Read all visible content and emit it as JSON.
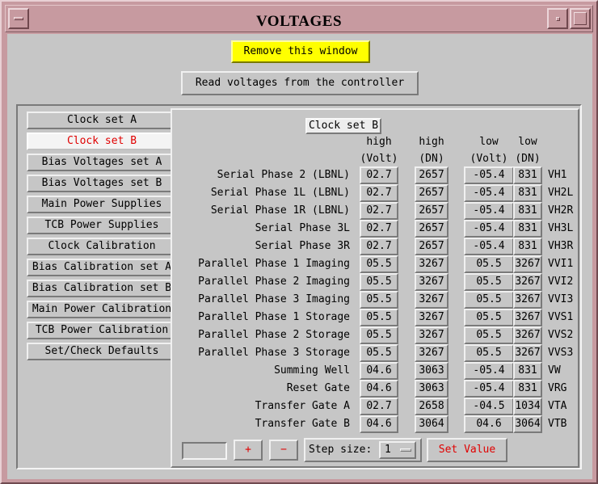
{
  "window": {
    "title": "VOLTAGES"
  },
  "buttons": {
    "remove": "Remove this window",
    "read": "Read voltages from the controller"
  },
  "tabs": [
    "Clock set A",
    "Clock set B",
    "Bias Voltages set A",
    "Bias Voltages set B",
    "Main Power Supplies",
    "TCB Power Supplies",
    "Clock Calibration",
    "Bias Calibration set A",
    "Bias Calibration set B",
    "Main Power Calibration",
    "TCB Power Calibration",
    "Set/Check Defaults"
  ],
  "active_tab": "Clock set B",
  "panel": {
    "title": "Clock set B",
    "columns": [
      {
        "top": "high",
        "bottom": "(Volt)"
      },
      {
        "top": "high",
        "bottom": "(DN)"
      },
      {
        "top": "low",
        "bottom": "(Volt)"
      },
      {
        "top": "low",
        "bottom": "(DN)"
      }
    ],
    "rows": [
      {
        "label": "Serial Phase 2  (LBNL)",
        "high_volt": "02.7",
        "high_dn": "2657",
        "low_volt": "-05.4",
        "low_dn": "831",
        "code": "VH1"
      },
      {
        "label": "Serial Phase 1L (LBNL)",
        "high_volt": "02.7",
        "high_dn": "2657",
        "low_volt": "-05.4",
        "low_dn": "831",
        "code": "VH2L"
      },
      {
        "label": "Serial Phase 1R (LBNL)",
        "high_volt": "02.7",
        "high_dn": "2657",
        "low_volt": "-05.4",
        "low_dn": "831",
        "code": "VH2R"
      },
      {
        "label": "Serial Phase 3L",
        "high_volt": "02.7",
        "high_dn": "2657",
        "low_volt": "-05.4",
        "low_dn": "831",
        "code": "VH3L"
      },
      {
        "label": "Serial Phase 3R",
        "high_volt": "02.7",
        "high_dn": "2657",
        "low_volt": "-05.4",
        "low_dn": "831",
        "code": "VH3R"
      },
      {
        "label": "Parallel Phase 1 Imaging",
        "high_volt": "05.5",
        "high_dn": "3267",
        "low_volt": "05.5",
        "low_dn": "3267",
        "code": "VVI1"
      },
      {
        "label": "Parallel Phase 2 Imaging",
        "high_volt": "05.5",
        "high_dn": "3267",
        "low_volt": "05.5",
        "low_dn": "3267",
        "code": "VVI2"
      },
      {
        "label": "Parallel Phase 3 Imaging",
        "high_volt": "05.5",
        "high_dn": "3267",
        "low_volt": "05.5",
        "low_dn": "3267",
        "code": "VVI3"
      },
      {
        "label": "Parallel Phase 1 Storage",
        "high_volt": "05.5",
        "high_dn": "3267",
        "low_volt": "05.5",
        "low_dn": "3267",
        "code": "VVS1"
      },
      {
        "label": "Parallel Phase 2 Storage",
        "high_volt": "05.5",
        "high_dn": "3267",
        "low_volt": "05.5",
        "low_dn": "3267",
        "code": "VVS2"
      },
      {
        "label": "Parallel Phase 3 Storage",
        "high_volt": "05.5",
        "high_dn": "3267",
        "low_volt": "05.5",
        "low_dn": "3267",
        "code": "VVS3"
      },
      {
        "label": "Summing Well",
        "high_volt": "04.6",
        "high_dn": "3063",
        "low_volt": "-05.4",
        "low_dn": "831",
        "code": "VW"
      },
      {
        "label": "Reset Gate",
        "high_volt": "04.6",
        "high_dn": "3063",
        "low_volt": "-05.4",
        "low_dn": "831",
        "code": "VRG"
      },
      {
        "label": "Transfer Gate A",
        "high_volt": "02.7",
        "high_dn": "2658",
        "low_volt": "-04.5",
        "low_dn": "1034",
        "code": "VTA"
      },
      {
        "label": "Transfer Gate B",
        "high_volt": "04.6",
        "high_dn": "3064",
        "low_volt": "04.6",
        "low_dn": "3064",
        "code": "VTB"
      }
    ]
  },
  "controls": {
    "value_input": "",
    "plus": "+",
    "minus": "−",
    "step_label": "Step size:",
    "step_value": "1",
    "set_value": "Set Value"
  },
  "colors": {
    "title_bar": "#c79aa0",
    "remove_button": "#ffff00",
    "active_tab_text": "#e00000",
    "set_value_text": "#e00000"
  },
  "icons": [
    "window-menu-icon",
    "minimize-icon",
    "maximize-icon"
  ]
}
